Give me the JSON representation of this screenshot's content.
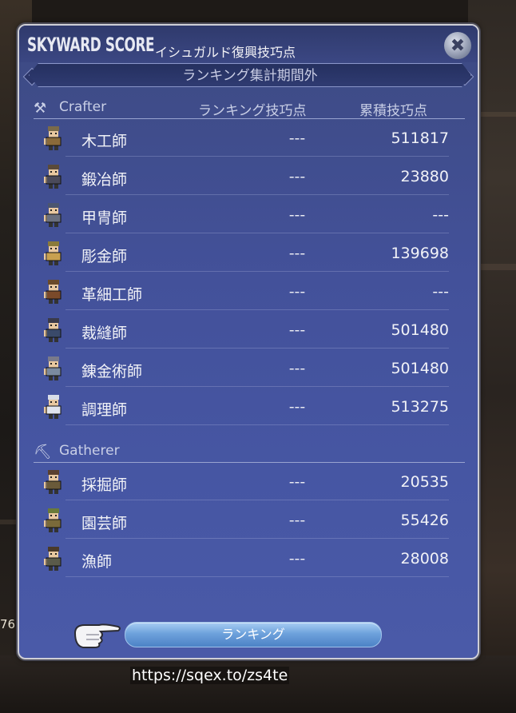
{
  "window": {
    "title_en": "SKYWARD SCORE",
    "title_jp": "イシュガルド復興技巧点",
    "close_icon": "close-crossed-hammers-icon",
    "period_status": "ランキング集計期間外"
  },
  "columns": {
    "ranking": "ランキング技巧点",
    "total": "累積技巧点"
  },
  "crafter": {
    "label": "Crafter",
    "icon": "hammer-icon",
    "rows": [
      {
        "name": "木工師",
        "rank": "---",
        "total": "511817"
      },
      {
        "name": "鍛冶師",
        "rank": "---",
        "total": "23880"
      },
      {
        "name": "甲冑師",
        "rank": "---",
        "total": "---"
      },
      {
        "name": "彫金師",
        "rank": "---",
        "total": "139698"
      },
      {
        "name": "革細工師",
        "rank": "---",
        "total": "---"
      },
      {
        "name": "裁縫師",
        "rank": "---",
        "total": "501480"
      },
      {
        "name": "錬金術師",
        "rank": "---",
        "total": "501480"
      },
      {
        "name": "調理師",
        "rank": "---",
        "total": "513275"
      }
    ]
  },
  "gatherer": {
    "label": "Gatherer",
    "icon": "pickaxe-icon",
    "rows": [
      {
        "name": "採掘師",
        "rank": "---",
        "total": "20535"
      },
      {
        "name": "園芸師",
        "rank": "---",
        "total": "55426"
      },
      {
        "name": "漁師",
        "rank": "---",
        "total": "28008"
      }
    ]
  },
  "ranking_button": "ランキング",
  "url_text": "https://sqex.to/zs4te",
  "edge_text": "76"
}
